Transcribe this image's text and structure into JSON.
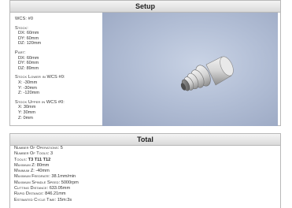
{
  "setup": {
    "title": "Setup",
    "wcs": "WCS: #0",
    "stock": {
      "title": "Stock:",
      "dx": "DX: 60mm",
      "dy": "DY: 60mm",
      "dz": "DZ: 120mm"
    },
    "part": {
      "title": "Part:",
      "dx": "DX: 60mm",
      "dy": "DY: 60mm",
      "dz": "DZ: 89mm"
    },
    "stock_lower": {
      "title": "Stock Lower in WCS #0:",
      "x": "X: -30mm",
      "y": "Y: -30mm",
      "z": "Z: -120mm"
    },
    "stock_upper": {
      "title": "Stock Upper in WCS #0:",
      "x": "X: 30mm",
      "y": "Y: 30mm",
      "z": "Z: 0mm"
    }
  },
  "total": {
    "title": "Total",
    "rows": [
      {
        "label": "Number Of Operations:",
        "value": "5"
      },
      {
        "label": "Number Of Tools:",
        "value": "3"
      },
      {
        "label": "Tools:",
        "value": "T3 T11 T12"
      },
      {
        "label": "Maximum Z:",
        "value": "80mm"
      },
      {
        "label": "Minimum Z:",
        "value": "-40mm"
      },
      {
        "label": "Maximum Feedrate:",
        "value": "38.1mm/min"
      },
      {
        "label": "Maximum Spindle Speed:",
        "value": "5000rpm"
      },
      {
        "label": "Cutting Distance:",
        "value": "633.05mm"
      },
      {
        "label": "Rapid Distance:",
        "value": "846.21mm"
      },
      {
        "label": "Estimated Cycle Time:",
        "value": "15m:3s"
      }
    ]
  },
  "colors": {
    "viewer_bg": "#b3bfd6",
    "part_metal": "#d8d8d8",
    "header_bg": "#dcdcdc"
  }
}
